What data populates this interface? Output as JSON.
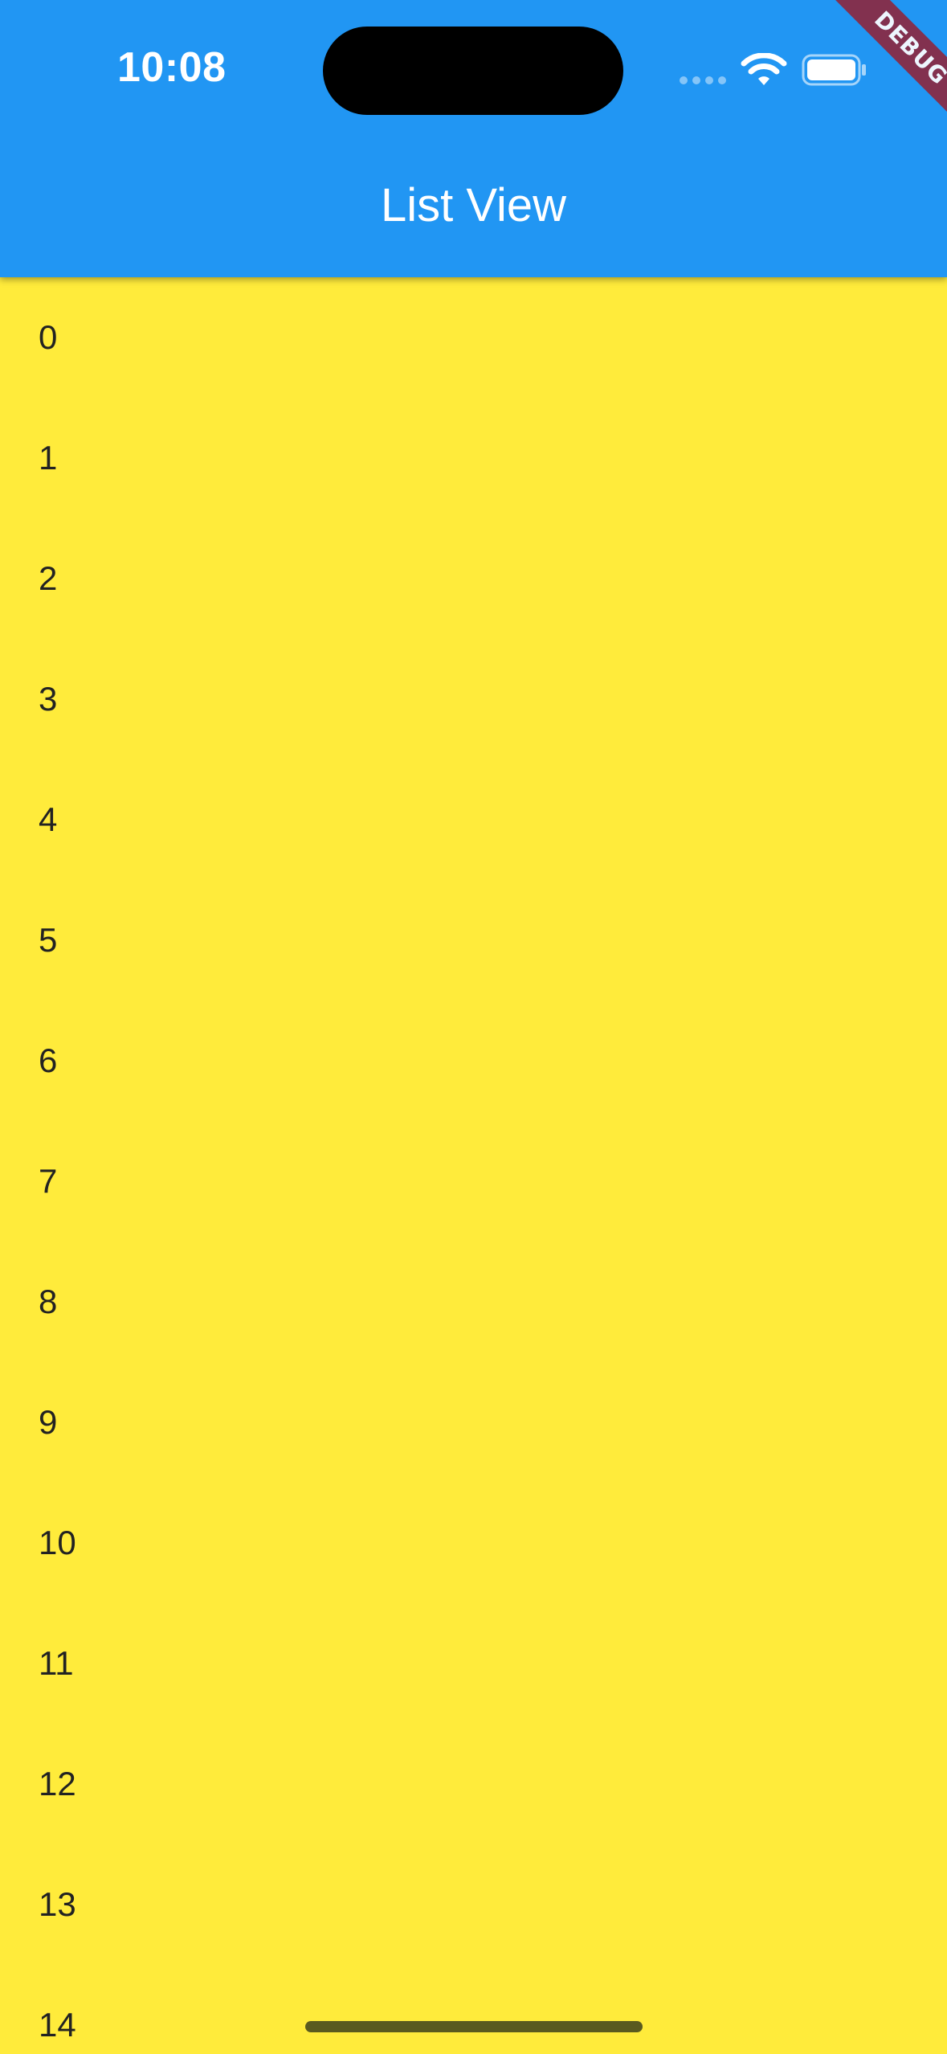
{
  "status_bar": {
    "time": "10:08"
  },
  "app_bar": {
    "title": "List View",
    "background_color": "#2196F3"
  },
  "debug_banner": {
    "label": "DEBUG"
  },
  "list": {
    "background_color": "#FFEB3B",
    "items": [
      "0",
      "1",
      "2",
      "3",
      "4",
      "5",
      "6",
      "7",
      "8",
      "9",
      "10",
      "11",
      "12",
      "13",
      "14"
    ]
  },
  "icons": {
    "signal": "cellular-signal-icon",
    "wifi": "wifi-icon",
    "battery": "battery-icon"
  }
}
